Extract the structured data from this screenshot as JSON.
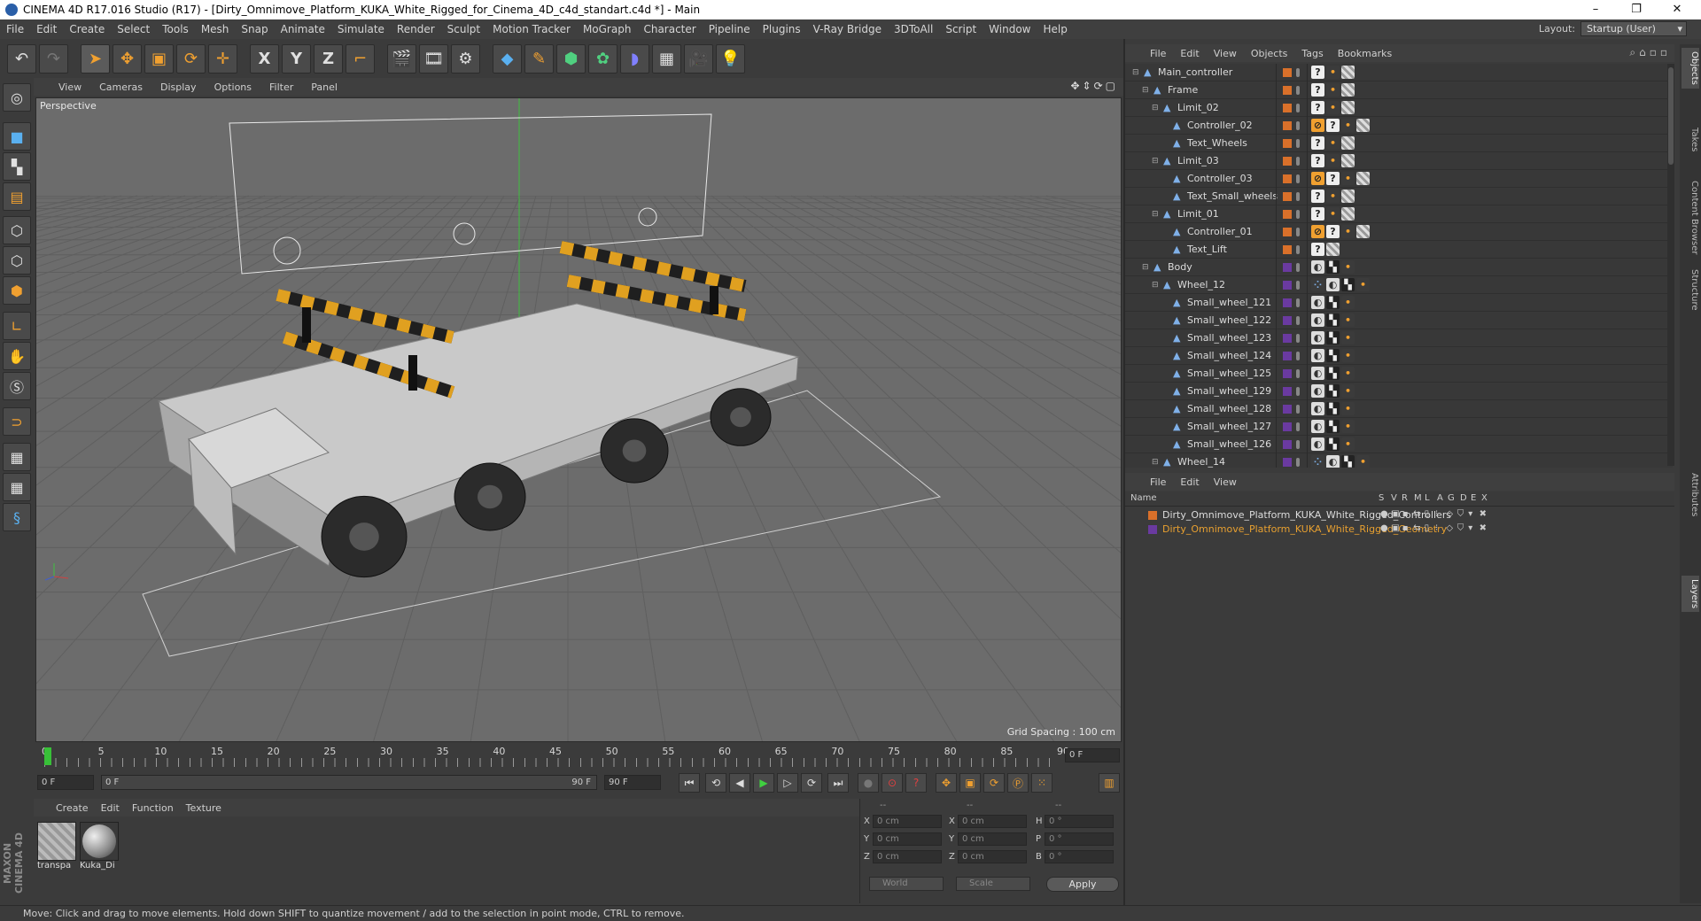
{
  "window": {
    "title": "CINEMA 4D R17.016 Studio (R17) - [Dirty_Omnimove_Platform_KUKA_White_Rigged_for_Cinema_4D_c4d_standart.c4d *] - Main",
    "minimize": "–",
    "maximize": "❐",
    "close": "✕"
  },
  "menubar": {
    "items": [
      "File",
      "Edit",
      "Create",
      "Select",
      "Tools",
      "Mesh",
      "Snap",
      "Animate",
      "Simulate",
      "Render",
      "Sculpt",
      "Motion Tracker",
      "MoGraph",
      "Character",
      "Pipeline",
      "Plugins",
      "V-Ray Bridge",
      "3DToAll",
      "Script",
      "Window",
      "Help"
    ],
    "layout_label": "Layout:",
    "layout_value": "Startup (User)"
  },
  "toolbar": {
    "icons": [
      "undo-icon",
      "redo-icon",
      "live-selection-icon",
      "move-icon",
      "scale-icon",
      "rotate-icon",
      "recent-tool-icon",
      "x-axis-icon",
      "y-axis-icon",
      "z-axis-icon",
      "coordinate-system-icon",
      "render-view-icon",
      "render-picture-viewer-icon",
      "render-settings-icon",
      "cube-icon",
      "pen-icon",
      "subdivision-icon",
      "array-icon",
      "deformer-icon",
      "floor-icon",
      "camera-icon",
      "light-icon"
    ],
    "x": "X",
    "y": "Y",
    "z": "Z"
  },
  "viewport": {
    "menu": [
      "View",
      "Cameras",
      "Display",
      "Options",
      "Filter",
      "Panel"
    ],
    "label": "Perspective",
    "grid_spacing": "Grid Spacing : 100 cm",
    "colors": {
      "bg": "#6c6c6c",
      "grid": "#5f5f5f",
      "platform": "#c9c9c9",
      "wheel": "#2b2b2b",
      "stripe_yellow": "#e0a020"
    }
  },
  "timeline": {
    "ticks": [
      "0",
      "5",
      "10",
      "15",
      "20",
      "25",
      "30",
      "35",
      "40",
      "45",
      "50",
      "55",
      "60",
      "65",
      "70",
      "75",
      "80",
      "85",
      "90"
    ],
    "current_frame": "0 F",
    "start": "0 F",
    "range_start": "0 F",
    "range_end": "90 F",
    "end": "90 F"
  },
  "material_manager": {
    "menu": [
      "Create",
      "Edit",
      "Function",
      "Texture"
    ],
    "materials": [
      {
        "name": "transpa",
        "kind": "transparent"
      },
      {
        "name": "Kuka_Di",
        "kind": "sphere"
      }
    ]
  },
  "coordinates": {
    "headers": [
      "--",
      "--",
      "--"
    ],
    "rows": [
      {
        "axis": "X",
        "pos": "0 cm",
        "axis2": "X",
        "size": "0 cm",
        "rlabel": "H",
        "rot": "0 °"
      },
      {
        "axis": "Y",
        "pos": "0 cm",
        "axis2": "Y",
        "size": "0 cm",
        "rlabel": "P",
        "rot": "0 °"
      },
      {
        "axis": "Z",
        "pos": "0 cm",
        "axis2": "Z",
        "size": "0 cm",
        "rlabel": "B",
        "rot": "0 °"
      }
    ],
    "mode": "World",
    "scale": "Scale",
    "apply": "Apply"
  },
  "status": "Move: Click and drag to move elements. Hold down SHIFT to quantize movement / add to the selection in point mode, CTRL to remove.",
  "maxon": "MAXON CINEMA 4D",
  "object_manager": {
    "menu": [
      "File",
      "Edit",
      "View",
      "Objects",
      "Tags",
      "Bookmarks"
    ],
    "objects": [
      {
        "name": "Main_controller",
        "depth": 0,
        "layer": "orange",
        "tags": [
          "q",
          "dots",
          "check"
        ]
      },
      {
        "name": "Frame",
        "depth": 1,
        "layer": "orange",
        "tags": [
          "q",
          "dots",
          "check"
        ]
      },
      {
        "name": "Limit_02",
        "depth": 2,
        "layer": "orange",
        "tags": [
          "q",
          "dots",
          "check"
        ]
      },
      {
        "name": "Controller_02",
        "depth": 3,
        "layer": "orange",
        "tags": [
          "no",
          "q",
          "dots",
          "check"
        ]
      },
      {
        "name": "Text_Wheels",
        "depth": 3,
        "layer": "orange",
        "tags": [
          "q",
          "dots",
          "check"
        ]
      },
      {
        "name": "Limit_03",
        "depth": 2,
        "layer": "orange",
        "tags": [
          "q",
          "dots",
          "check"
        ]
      },
      {
        "name": "Controller_03",
        "depth": 3,
        "layer": "orange",
        "tags": [
          "no",
          "q",
          "dots",
          "check"
        ]
      },
      {
        "name": "Text_Small_wheels",
        "depth": 3,
        "layer": "orange",
        "tags": [
          "q",
          "dots",
          "check"
        ]
      },
      {
        "name": "Limit_01",
        "depth": 2,
        "layer": "orange",
        "tags": [
          "q",
          "dots",
          "check"
        ]
      },
      {
        "name": "Controller_01",
        "depth": 3,
        "layer": "orange",
        "tags": [
          "no",
          "q",
          "dots",
          "check"
        ]
      },
      {
        "name": "Text_Lift",
        "depth": 3,
        "layer": "orange",
        "tags": [
          "q",
          "check"
        ]
      },
      {
        "name": "Body",
        "depth": 1,
        "layer": "purple",
        "tags": [
          "phong",
          "checker",
          "dots"
        ]
      },
      {
        "name": "Wheel_12",
        "depth": 2,
        "layer": "purple",
        "tags": [
          "xpresso",
          "phong",
          "checker",
          "dots"
        ]
      },
      {
        "name": "Small_wheel_121",
        "depth": 3,
        "layer": "purple",
        "tags": [
          "phong",
          "checker",
          "dots"
        ]
      },
      {
        "name": "Small_wheel_122",
        "depth": 3,
        "layer": "purple",
        "tags": [
          "phong",
          "checker",
          "dots"
        ]
      },
      {
        "name": "Small_wheel_123",
        "depth": 3,
        "layer": "purple",
        "tags": [
          "phong",
          "checker",
          "dots"
        ]
      },
      {
        "name": "Small_wheel_124",
        "depth": 3,
        "layer": "purple",
        "tags": [
          "phong",
          "checker",
          "dots"
        ]
      },
      {
        "name": "Small_wheel_125",
        "depth": 3,
        "layer": "purple",
        "tags": [
          "phong",
          "checker",
          "dots"
        ]
      },
      {
        "name": "Small_wheel_129",
        "depth": 3,
        "layer": "purple",
        "tags": [
          "phong",
          "checker",
          "dots"
        ]
      },
      {
        "name": "Small_wheel_128",
        "depth": 3,
        "layer": "purple",
        "tags": [
          "phong",
          "checker",
          "dots"
        ]
      },
      {
        "name": "Small_wheel_127",
        "depth": 3,
        "layer": "purple",
        "tags": [
          "phong",
          "checker",
          "dots"
        ]
      },
      {
        "name": "Small_wheel_126",
        "depth": 3,
        "layer": "purple",
        "tags": [
          "phong",
          "checker",
          "dots"
        ]
      },
      {
        "name": "Wheel_14",
        "depth": 2,
        "layer": "purple",
        "tags": [
          "xpresso",
          "phong",
          "checker",
          "dots"
        ]
      }
    ]
  },
  "layer_manager": {
    "menu": [
      "File",
      "Edit",
      "View"
    ],
    "columns": [
      "Name",
      "S",
      "V",
      "R",
      "M",
      "L",
      "A",
      "G",
      "D",
      "E",
      "X"
    ],
    "layers": [
      {
        "name": "Dirty_Omnimove_Platform_KUKA_White_Rigged_Controllers",
        "color": "#d9702a",
        "text_color": "#dcdcdc"
      },
      {
        "name": "Dirty_Omnimove_Platform_KUKA_White_Rigged_Geometry",
        "color": "#6a3aa0",
        "text_color": "#e8a030"
      }
    ]
  },
  "right_tabs": [
    "Objects",
    "Takes",
    "Content Browser",
    "Structure",
    "Attributes",
    "Layers"
  ]
}
